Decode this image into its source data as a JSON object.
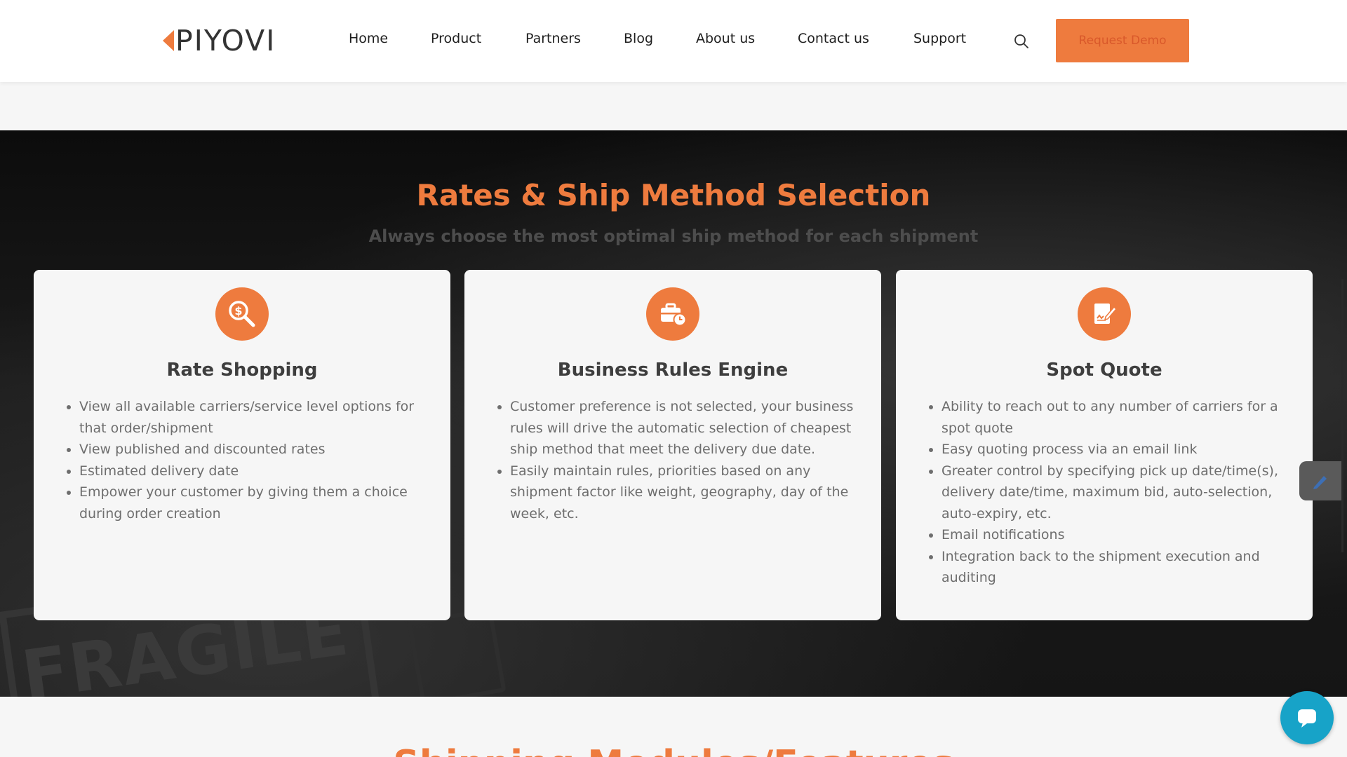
{
  "header": {
    "logo_text": "PIYOVI",
    "nav": [
      "Home",
      "Product",
      "Partners",
      "Blog",
      "About us",
      "Contact us",
      "Support"
    ],
    "search_icon": "search-icon",
    "cta_label": "Request Demo"
  },
  "hero": {
    "title": "Rates & Ship Method Selection",
    "subtitle": "Always choose the most optimal ship method for each shipment",
    "background_text": "FRAGILE"
  },
  "cards": [
    {
      "icon": "dollar-search-icon",
      "title": "Rate Shopping",
      "bullets": [
        "View all available carriers/service level options for that order/shipment",
        "View published and discounted rates",
        "Estimated delivery date",
        "Empower your customer by giving them a choice during order creation"
      ]
    },
    {
      "icon": "briefcase-clock-icon",
      "title": "Business Rules Engine",
      "bullets": [
        "Customer preference is not selected, your business rules will drive the automatic selection of cheapest ship method that meet the delivery due date.",
        "Easily maintain rules,  priorities based on any shipment factor like weight, geography, day of the week, etc."
      ]
    },
    {
      "icon": "document-sign-icon",
      "title": "Spot Quote",
      "bullets": [
        "Ability to reach out to any number of carriers for a spot quote",
        "Easy quoting process via an email link",
        "Greater control by specifying pick up date/time(s), delivery date/time, maximum bid, auto-selection, auto-expiry, etc.",
        "Email notifications",
        "Integration back to the shipment execution and auditing"
      ]
    }
  ],
  "next_section": {
    "heading_partial": "Shipping Modules/Features"
  },
  "colors": {
    "accent": "#ee7b3e",
    "chat": "#17a3c8"
  }
}
